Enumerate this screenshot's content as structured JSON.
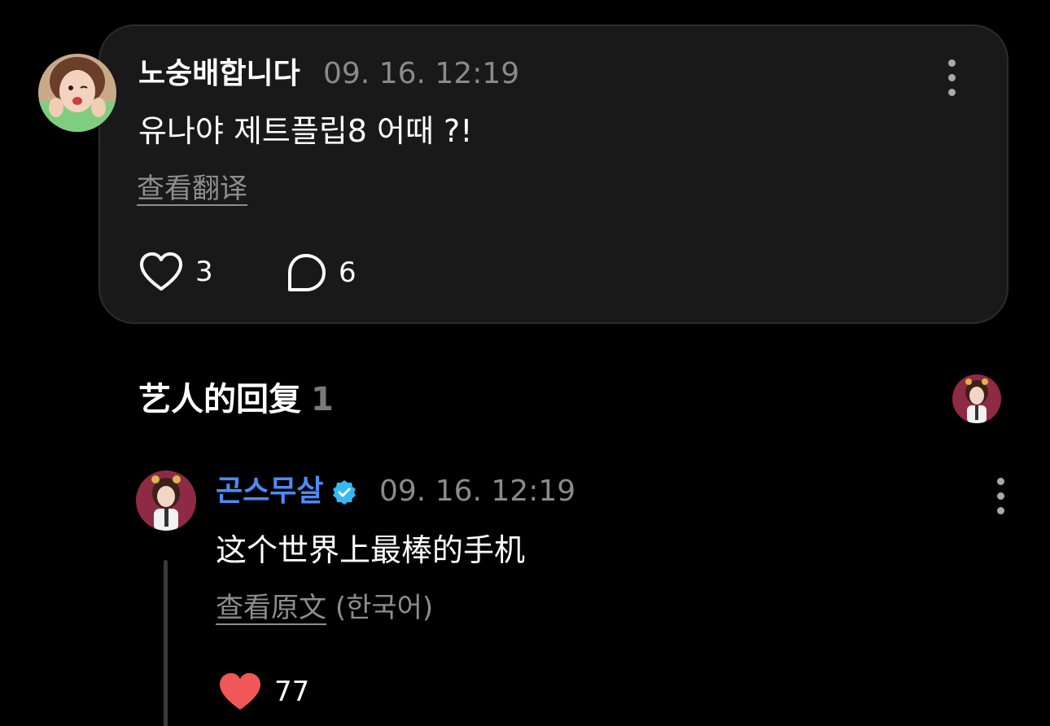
{
  "colors": {
    "background": "#000000",
    "card": "#191919",
    "artist_name": "#4a8cf7",
    "verified_badge": "#35b8f3",
    "liked_heart": "#f25757",
    "muted_text": "#8a8a8a"
  },
  "comment": {
    "username": "노숭배합니다",
    "timestamp": "09. 16. 12:19",
    "text": "유나야 제트플립8 어때 ?!",
    "translate_label": "查看翻译",
    "likes": "3",
    "replies": "6",
    "icons": {
      "like": "heart-outline-icon",
      "reply": "speech-bubble-icon",
      "more": "vertical-dots-icon"
    }
  },
  "artist_replies": {
    "title": "艺人的回复",
    "count": "1",
    "reply": {
      "username": "곤스무살",
      "verified": true,
      "timestamp": "09. 16. 12:19",
      "text": "这个世界上最棒的手机",
      "original_label": "查看原文",
      "original_language": "(한국어)",
      "likes": "77",
      "liked": true
    }
  }
}
